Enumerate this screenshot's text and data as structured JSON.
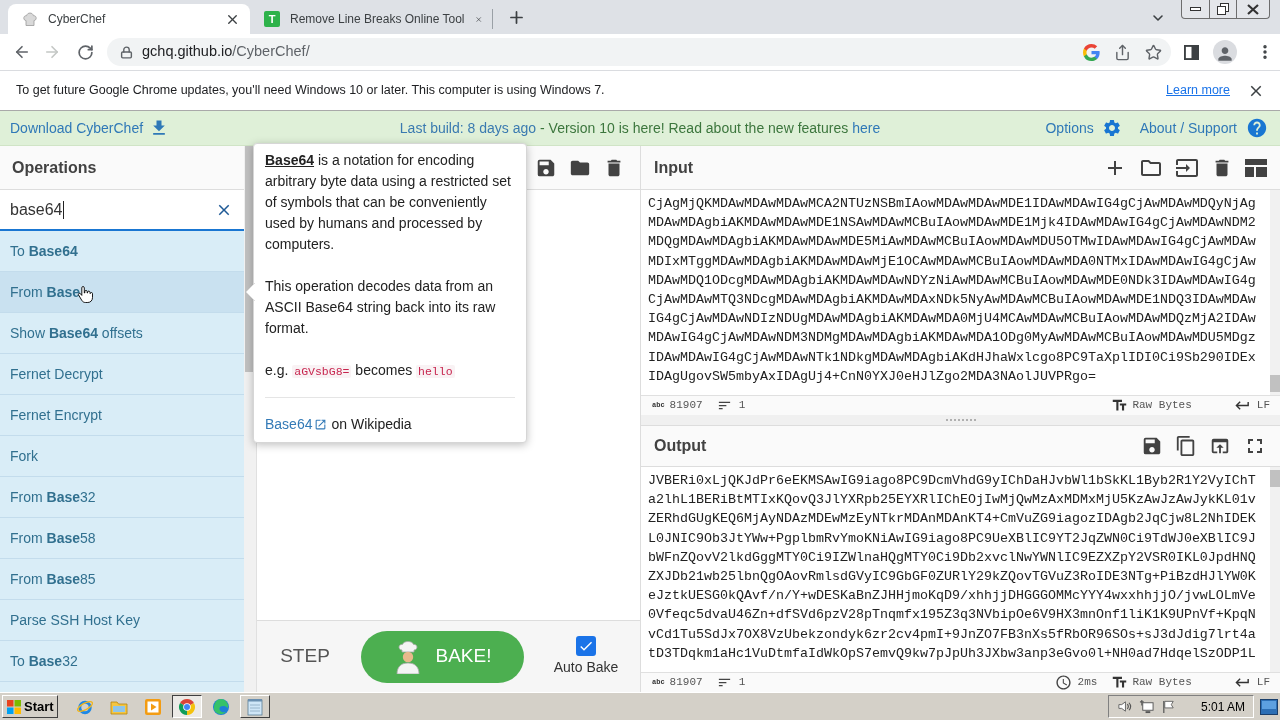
{
  "browser": {
    "tabs": [
      {
        "kind": "chef",
        "title": "CyberChef",
        "selected": true
      },
      {
        "kind": "letter",
        "favicon_text": "T",
        "title": "Remove Line Breaks Online Tool",
        "selected": false
      }
    ],
    "forward": {
      "disabled": true
    },
    "address": {
      "host": "gchq.github.io",
      "path": "/CyberChef/"
    },
    "infobar": {
      "message": "To get future Google Chrome updates, you'll need Windows 10 or later. This computer is using Windows 7.",
      "link": "Learn more"
    }
  },
  "banner": {
    "download": "Download CyberChef",
    "build": "Last build: 8 days ago",
    "notice": "- Version 10 is here! Read about the new features",
    "notice_link": "here",
    "options": "Options",
    "about": "About / Support"
  },
  "operations": {
    "title": "Operations",
    "search": {
      "value": "base64"
    },
    "items": [
      {
        "label": "To **Base64**",
        "highlighted": false
      },
      {
        "label": "From **Base**",
        "highlighted": true
      },
      {
        "label": "Show **Base64** offsets",
        "highlighted": false
      },
      {
        "label": "Fernet Decrypt",
        "highlighted": false
      },
      {
        "label": "Fernet Encrypt",
        "highlighted": false
      },
      {
        "label": "Fork",
        "highlighted": false
      },
      {
        "label": "From **Base**32",
        "highlighted": false
      },
      {
        "label": "From **Base**58",
        "highlighted": false
      },
      {
        "label": "From **Base**85",
        "highlighted": false
      },
      {
        "label": "Parse SSH Host Key",
        "highlighted": false
      },
      {
        "label": "To **Base**32",
        "highlighted": false
      }
    ]
  },
  "popover": {
    "description": "**Base64** is a notation for encoding arbitrary byte data using a restricted set of symbols that can be conveniently used by humans and processed by computers.",
    "details": "This operation decodes data from an ASCII Base64 string back into its raw format.",
    "example": {
      "prefix": "e.g.",
      "input": "aGVsbG8=",
      "middle": "becomes",
      "output": "hello"
    },
    "link": "Base64",
    "link_suffix": "on Wikipedia"
  },
  "recipe": {
    "step": "STEP",
    "bake": "BAKE!",
    "auto_bake": {
      "label": "Auto Bake",
      "checked": true
    }
  },
  "input": {
    "title": "Input",
    "lines": [
      "CjAgMjQKMDAwMDAwMDAwMCA2NTUzNSBmIAowMDAwMDAwMDE1IDAwMDAwIG4gCjAwMDAwMDQyNjAg",
      "MDAwMDAgbiAKMDAwMDAwMDE1NSAwMDAwMCBuIAowMDAwMDE1Mjk4IDAwMDAwIG4gCjAwMDAwNDM2",
      "MDQgMDAwMDAgbiAKMDAwMDAwMDE5MiAwMDAwMCBuIAowMDAwMDU5OTMwIDAwMDAwIG4gCjAwMDAw",
      "MDIxMTggMDAwMDAgbiAKMDAwMDAwMjE1OCAwMDAwMCBuIAowMDAwMDA0NTMxIDAwMDAwIG4gCjAw",
      "MDAwMDQ1ODcgMDAwMDAgbiAKMDAwMDAwNDYzNiAwMDAwMCBuIAowMDAwMDE0NDk3IDAwMDAwIG4g",
      "CjAwMDAwMTQ3NDcgMDAwMDAgbiAKMDAwMDAxNDk5NyAwMDAwMCBuIAowMDAwMDE1NDQ3IDAwMDAw",
      "IG4gCjAwMDAwNDIzNDUgMDAwMDAgbiAKMDAwMDA0MjU4MCAwMDAwMCBuIAowMDAwMDQzMjA2IDAw",
      "MDAwIG4gCjAwMDAwNDM3NDMgMDAwMDAgbiAKMDAwMDA1ODg0MyAwMDAwMCBuIAowMDAwMDU5MDgz",
      "IDAwMDAwIG4gCjAwMDAwNTk1NDkgMDAwMDAgbiAKdHJhaWxlcgo8PC9TaXplIDI0Ci9Sb290IDEx",
      "IDAgUgovSW5mbyAxIDAgUj4+CnN0YXJ0eHJlZgo2MDA3NAolJUVPRgo="
    ],
    "status": {
      "length_glyph": "abc",
      "length": "81907",
      "lines": "1",
      "encoding": "Raw Bytes",
      "eol": "LF"
    }
  },
  "output": {
    "title": "Output",
    "lines": [
      "JVBERi0xLjQKJdPr6eEKMSAwIG9iago8PC9DcmVhdG9yIChDaHJvbWl1bSkKL1Byb2R1Y2VyIChT",
      "a2lhL1BERiBtMTIxKQovQ3JlYXRpb25EYXRlIChEOjIwMjQwMzAxMDMxMjU5KzAwJzAwJykKL01v",
      "ZERhdGUgKEQ6MjAyNDAzMDEwMzEyNTkrMDAnMDAnKT4+CmVuZG9iagozIDAgb2JqCjw8L2NhIDEK",
      "L0JNIC9Ob3JtYWw+PgplbmRvYmoKNiAwIG9iago8PC9UeXBlIC9YT2JqZWN0Ci9TdWJ0eXBlIC9J",
      "bWFnZQovV2lkdGggMTY0Ci9IZWlnaHQgMTY0Ci9Db2xvclNwYWNlIC9EZXZpY2VSR0IKL0JpdHNQ",
      "ZXJDb21wb25lbnQgOAovRmlsdGVyIC9GbGF0ZURlY29kZQovTGVuZ3RoIDE3NTg+PiBzdHJlYW0K",
      "eJztkUESG0kQAvf/n/Y+wDESKaBnZJHHjmoKqD9/xhhjjDHGGGOMMcYYY4wxxhhjjO/jvwLOLmVe",
      "0Vfeqc5dvaU46Zn+dfSVd6pzV28pTnqmfx195Z3q3NVbipOe6V9HX3mnOnf1liK1K9UPnVf+KpqN",
      "vCd1Tu5SdJx7OX8VzUbekzondyk6zr2cv4pmI+9JnZO7FB3nXs5fRbOR96SOs+sJ3dJdig7lrt4a",
      "tD3TDqkm1aHc1VuDtmfaIdWkOpS7emvQ9kw7pJpUh3JXbw3anp3eGvo0l+NH0ad7HdqelSzODP1L"
    ],
    "status": {
      "length_glyph": "abc",
      "length": "81907",
      "lines": "1",
      "time": "2ms",
      "encoding": "Raw Bytes",
      "eol": "LF"
    }
  },
  "taskbar": {
    "start": "Start",
    "apps": [
      {
        "kind": "orbit",
        "window": false,
        "selected": false
      },
      {
        "kind": "folder",
        "window": false,
        "selected": false
      },
      {
        "kind": "play",
        "window": false,
        "selected": false
      },
      {
        "kind": "browser",
        "window": true,
        "selected": true
      },
      {
        "kind": "wave",
        "window": false,
        "selected": false
      },
      {
        "kind": "notepad",
        "window": true,
        "selected": false
      }
    ],
    "clock": "5:01 AM"
  }
}
